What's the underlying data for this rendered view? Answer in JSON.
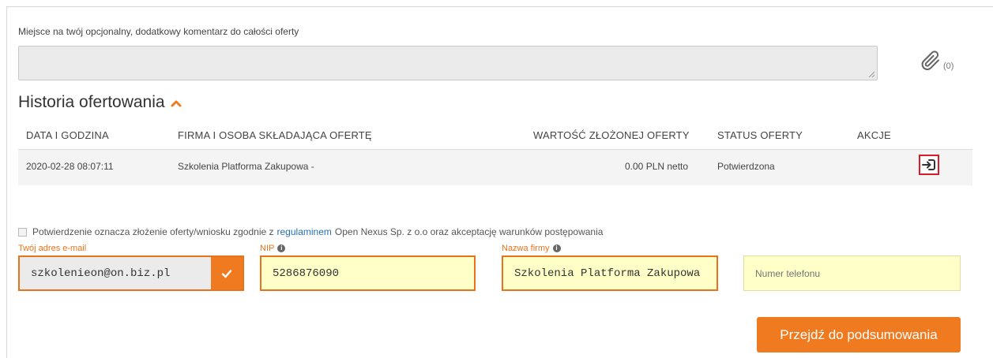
{
  "comment": {
    "label": "Miejsce na twój opcjonalny, dodatkowy komentarz do całości oferty",
    "value": "",
    "attachments_count": "(0)"
  },
  "history": {
    "title": "Historia ofertowania",
    "columns": [
      "DATA I GODZINA",
      "FIRMA I OSOBA SKŁADAJĄCA OFERTĘ",
      "WARTOŚĆ ZŁOŻONEJ OFERTY",
      "STATUS OFERTY",
      "AKCJE"
    ],
    "rows": [
      {
        "date": "2020-02-28 08:07:11",
        "company": "Szkolenia Platforma Zakupowa -",
        "value": "0.00 PLN netto",
        "status": "Potwierdzona"
      }
    ]
  },
  "consent": {
    "before": "Potwierdzenie oznacza złożenie oferty/wniosku zgodnie z",
    "link": "regulaminem",
    "after": "Open Nexus Sp. z o.o oraz akceptację warunków postępowania",
    "checked": false
  },
  "form": {
    "email_label": "Twój adres e-mail",
    "email_value": "szkolenieon@on.biz.pl",
    "nip_label": "NIP",
    "nip_value": "5286876090",
    "company_label": "Nazwa firmy",
    "company_value": "Szkolenia Platforma Zakupowa",
    "phone_placeholder": "Numer telefonu",
    "phone_value": ""
  },
  "submit_label": "Przejdź do podsumowania",
  "colors": {
    "accent": "#f07a1f",
    "highlight_border": "#d61f2c",
    "input_yellow": "#ffffc8",
    "link": "#2a6fb0"
  }
}
